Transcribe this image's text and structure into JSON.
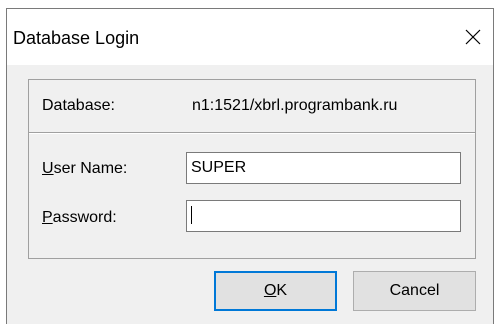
{
  "window": {
    "title": "Database Login",
    "close_icon": "close-icon"
  },
  "form": {
    "database_label": "Database:",
    "database_value": "n1:1521/xbrl.programbank.ru",
    "username_label_mnemonic": "U",
    "username_label_rest": "ser Name:",
    "username_value": "SUPER",
    "password_label_mnemonic": "P",
    "password_label_rest": "assword:",
    "password_value": ""
  },
  "buttons": {
    "ok_mnemonic": "O",
    "ok_rest": "K",
    "cancel_label": "Cancel"
  },
  "colors": {
    "dialog_bg": "#f0f0f0",
    "titlebar_bg": "#ffffff",
    "default_button_border": "#0078d7"
  }
}
